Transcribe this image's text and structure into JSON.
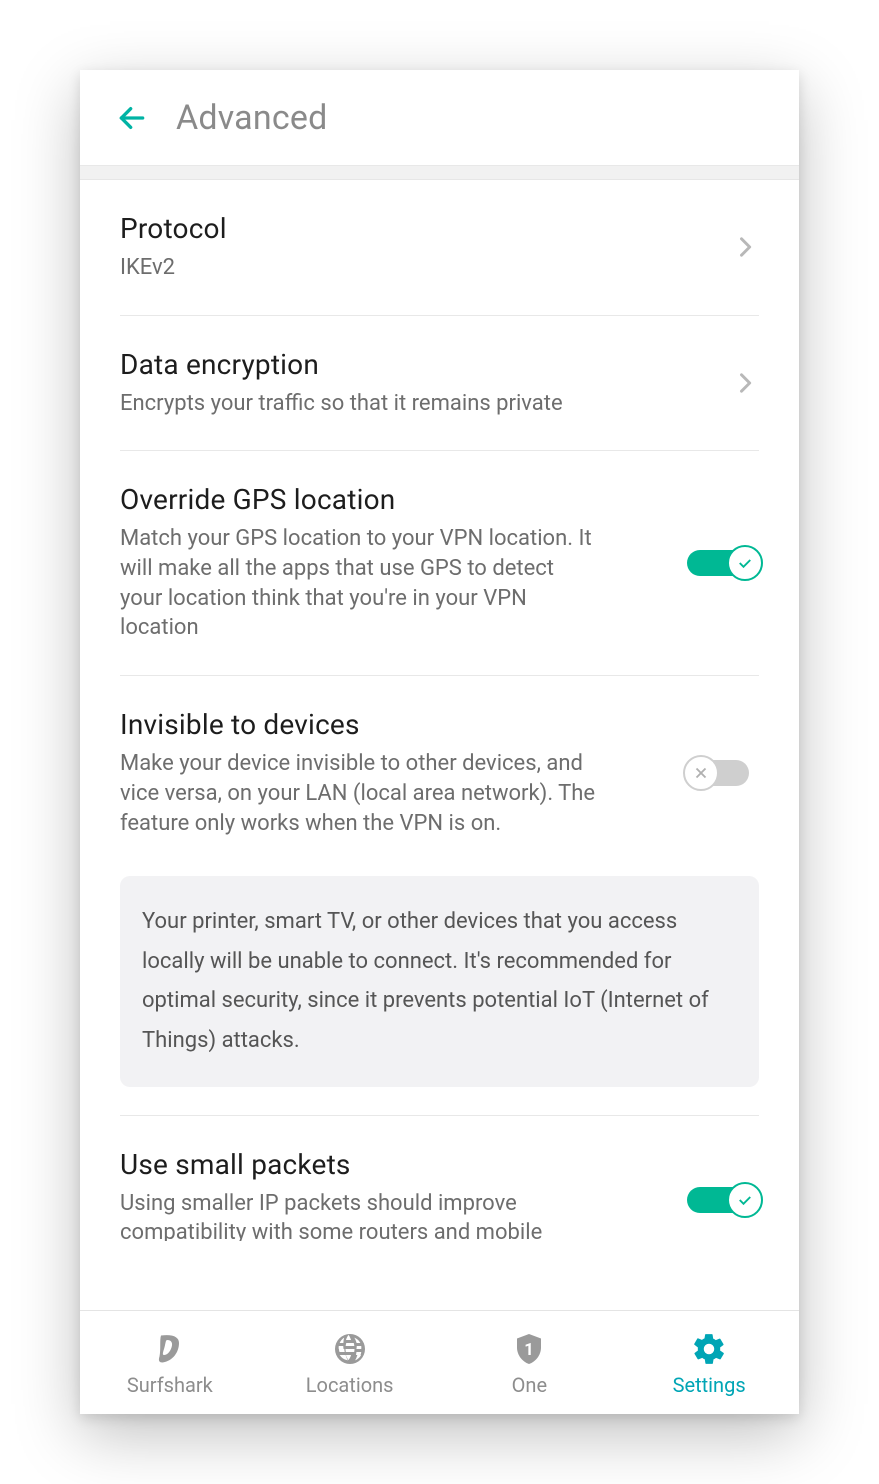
{
  "header": {
    "title": "Advanced"
  },
  "rows": {
    "protocol": {
      "title": "Protocol",
      "sub": "IKEv2"
    },
    "encryption": {
      "title": "Data encryption",
      "sub": "Encrypts your traffic so that it remains private"
    },
    "gps": {
      "title": "Override GPS location",
      "sub": "Match your GPS location to your VPN location. It will make all the apps that use GPS to detect your location think that you're in your VPN location",
      "on": true
    },
    "invisible": {
      "title": "Invisible to devices",
      "sub": "Make your device invisible to other devices, and vice versa, on your LAN (local area network). The feature only works when the VPN is on.",
      "on": false
    },
    "smallpkts": {
      "title": "Use small packets",
      "sub": "Using smaller IP packets should improve compatibility with some routers and mobile",
      "on": true
    }
  },
  "info": {
    "invisible_note": "Your printer, smart TV, or other devices that you access locally will be unable to connect. It's recommended for optimal security, since it prevents potential IoT (Internet of Things) attacks."
  },
  "nav": {
    "surfshark": "Surfshark",
    "locations": "Locations",
    "one": "One",
    "settings": "Settings"
  }
}
